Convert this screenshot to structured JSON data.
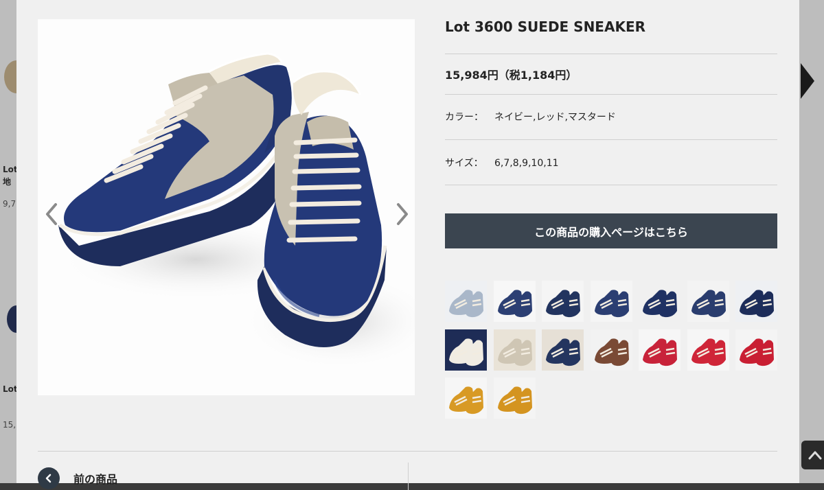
{
  "background": {
    "fragments": [
      {
        "id": "lot-1",
        "text": "Lot"
      },
      {
        "id": "ji",
        "text": "地"
      },
      {
        "id": "price-1",
        "text": "9,7"
      },
      {
        "id": "lot-2",
        "text": "Lot"
      },
      {
        "id": "price-2",
        "text": "15,"
      }
    ]
  },
  "product": {
    "title": "Lot 3600 SUEDE SNEAKER",
    "price": "15,984円（税1,184円）",
    "color_label": "カラー：",
    "color_value": "ネイビー,レッド,マスタード",
    "size_label": "サイズ：",
    "size_value": "6,7,8,9,10,11",
    "buy_button_label": "この商品の購入ページはこちら"
  },
  "gallery": {
    "thumbnails": [
      {
        "name": "light-blue-pair",
        "bg": "#eef0f3",
        "shoe": "#a9b7c9"
      },
      {
        "name": "navy-pair-front",
        "bg": "#f7f7f7",
        "shoe": "#2c3f73"
      },
      {
        "name": "navy-pair-side",
        "bg": "#f5f5f5",
        "shoe": "#22345f"
      },
      {
        "name": "navy-top-view",
        "bg": "#f5f5f5",
        "shoe": "#2b3e72"
      },
      {
        "name": "navy-heel-close",
        "bg": "#f0f0f0",
        "shoe": "#1f3163"
      },
      {
        "name": "navy-back-pair",
        "bg": "#f3f3f3",
        "shoe": "#2a3d6e"
      },
      {
        "name": "navy-sole-stripe",
        "bg": "#eef0f3",
        "shoe": "#1d2d5a"
      },
      {
        "name": "warehouse-tag-navy",
        "bg": "#1e2c56",
        "shoe": "#f0ece3"
      },
      {
        "name": "warehouse-insole",
        "bg": "#e9e3d7",
        "shoe": "#cfc6b4"
      },
      {
        "name": "laces-close",
        "bg": "#e6e0d6",
        "shoe": "#24355f"
      },
      {
        "name": "sole-bottom",
        "bg": "#f2f2f2",
        "shoe": "#7a4a35"
      },
      {
        "name": "red-pair-front",
        "bg": "#f6f6f6",
        "shoe": "#c8233a"
      },
      {
        "name": "red-pair-side",
        "bg": "#f6f6f6",
        "shoe": "#cf2538"
      },
      {
        "name": "red-close",
        "bg": "#f4f4f4",
        "shoe": "#c91f33"
      },
      {
        "name": "mustard-pair-front",
        "bg": "#f6f6f6",
        "shoe": "#d89a25"
      },
      {
        "name": "mustard-close",
        "bg": "#f4f4f4",
        "shoe": "#d49420"
      }
    ]
  },
  "pager": {
    "prev_label": "前の商品"
  },
  "colors": {
    "button_bg": "#3b4550",
    "modal_bg": "#f0f0f0",
    "navy_suede": "#24397a",
    "beige_suede": "#c8c1b1"
  },
  "icons": {
    "prev_arrow": "chevron-left-icon",
    "next_arrow": "chevron-right-icon",
    "scroll_top": "chevron-up-icon"
  }
}
